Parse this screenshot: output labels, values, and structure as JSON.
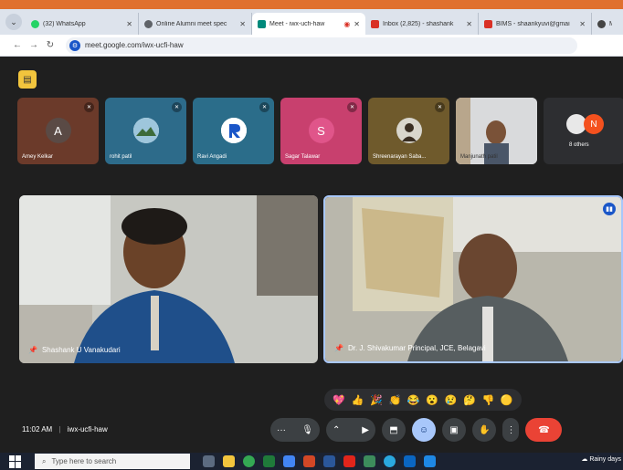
{
  "browser": {
    "tabs": [
      {
        "label": "(32) WhatsApp",
        "color": "#25d366",
        "active": false
      },
      {
        "label": "Online Alumni meet spec",
        "color": "#5f6368",
        "active": false
      },
      {
        "label": "Meet - iwx-ucfi-haw",
        "color": "#00897b",
        "active": true
      },
      {
        "label": "Inbox (2,825) - shashank",
        "color": "#d93025",
        "active": false
      },
      {
        "label": "BIMS - shaankyuvi@gmai",
        "color": "#d93025",
        "active": false
      },
      {
        "label": "M",
        "color": "#444444",
        "active": false
      }
    ],
    "url": "meet.google.com/iwx-ucfi-haw"
  },
  "meet": {
    "thumbnails": [
      {
        "name": "Amey Kelkar",
        "initial": "A",
        "bg": "#6b3a2a",
        "avatar_bg": "#5a4a45"
      },
      {
        "name": "rohit patil",
        "initial": "",
        "bg": "#2d6b8a",
        "avatar_bg": "#dfe6ea"
      },
      {
        "name": "Ravi Angadi",
        "initial": "",
        "bg": "#2b6d8a",
        "avatar_bg": "#ffffff"
      },
      {
        "name": "Sagar Talawar",
        "initial": "S",
        "bg": "#c8406e",
        "avatar_bg": "#e0558a"
      },
      {
        "name": "Shreenarayan Saba...",
        "initial": "",
        "bg": "#6f5a2c",
        "avatar_bg": "#3d3a30"
      },
      {
        "name": "Manjunath patil",
        "initial": "",
        "bg": "#dcdcdc",
        "avatar_bg": "#8a6a4a"
      }
    ],
    "others_label": "8 others",
    "others_initial": "N",
    "main_tiles": [
      {
        "name": "Shashank U Vanakudari"
      },
      {
        "name": "Dr. J. Shivakumar Principal, JCE, Belagavi"
      }
    ],
    "emojis": [
      "💖",
      "👍",
      "🎉",
      "👏",
      "😂",
      "😮",
      "😢",
      "🤔",
      "👎",
      "🟡"
    ],
    "time": "11:02 AM",
    "separator": "|",
    "meeting_code": "iwx-ucfi-haw"
  },
  "taskbar": {
    "search_placeholder": "Type here to search",
    "weather": "Rainy days"
  }
}
